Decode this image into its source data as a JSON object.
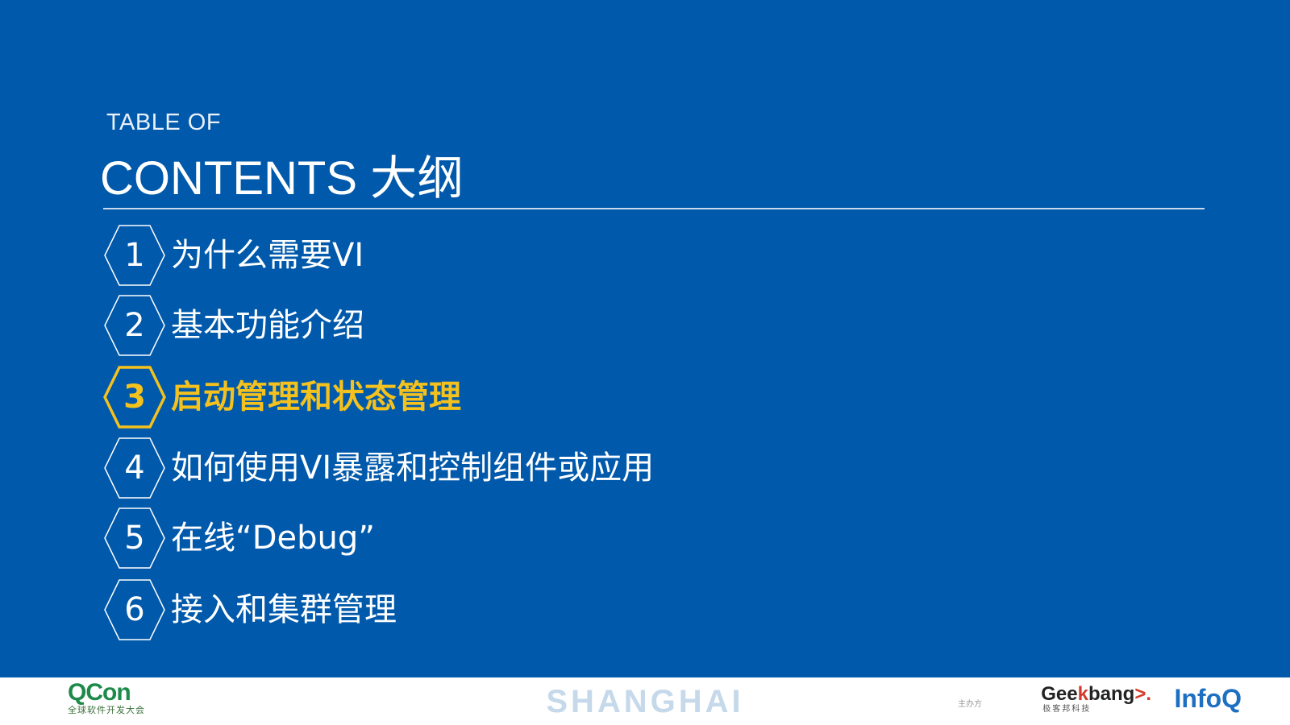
{
  "header": {
    "subtitle": "TABLE OF",
    "title": "CONTENTS 大纲"
  },
  "toc": {
    "items": [
      {
        "number": "1",
        "label": "为什么需要VI",
        "active": false
      },
      {
        "number": "2",
        "label": "基本功能介绍",
        "active": false
      },
      {
        "number": "3",
        "label": "启动管理和状态管理",
        "active": true
      },
      {
        "number": "4",
        "label": "如何使用VI暴露和控制组件或应用",
        "active": false
      },
      {
        "number": "5",
        "label": "在线“Debug”",
        "active": false
      },
      {
        "number": "6",
        "label": "接入和集群管理",
        "active": false
      }
    ]
  },
  "footer": {
    "qcon_logo": "QCon",
    "qcon_subtitle": "全球软件开发大会",
    "city": "SHANGHAI",
    "organizer_label": "主办方",
    "geekbang_logo_a": "Gee",
    "geekbang_logo_k": "k",
    "geekbang_logo_b": "bang",
    "geekbang_logo_chev": ">.",
    "geekbang_subtitle": "极客邦科技",
    "infoq_logo": "InfoQ"
  },
  "colors": {
    "background": "#0059ab",
    "active": "#f4c11d",
    "text": "#ffffff",
    "hex_outline": "#ffffff"
  },
  "icons": {
    "hexagon": "hexagon-outline-icon"
  }
}
